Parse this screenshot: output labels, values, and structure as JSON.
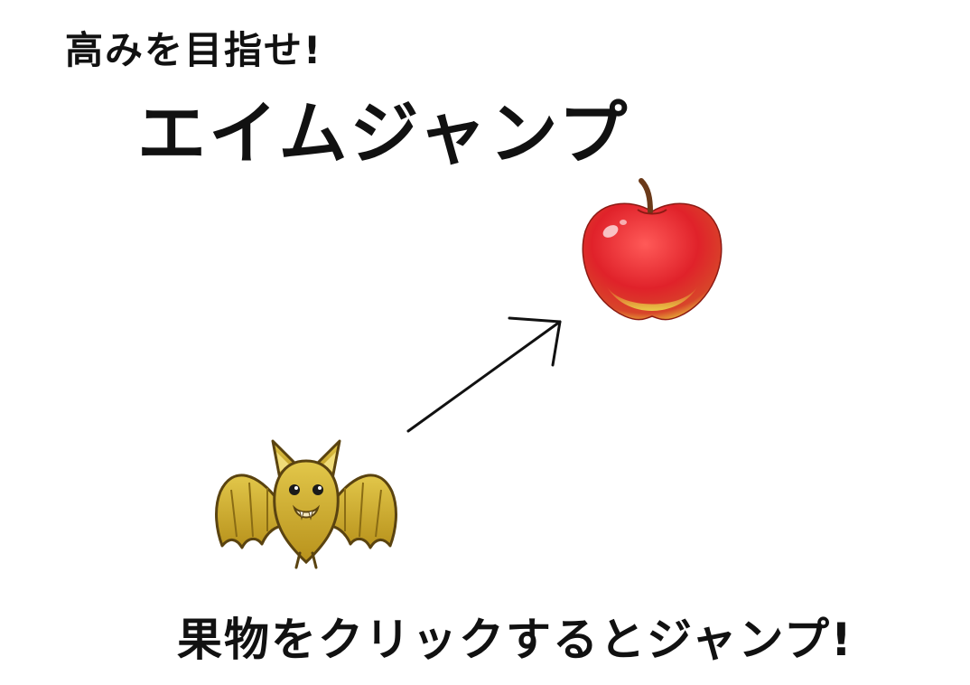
{
  "header": {
    "subtitle": "高みを目指せ!",
    "title": "エイムジャンプ"
  },
  "instruction": "果物をクリックするとジャンプ!",
  "icons": {
    "target": "apple-icon",
    "player": "bat-icon",
    "aim": "arrow-icon"
  },
  "colors": {
    "apple_red": "#e0222a",
    "apple_yellow": "#e9c83a",
    "bat_gold": "#c9a626",
    "text": "#111111"
  }
}
